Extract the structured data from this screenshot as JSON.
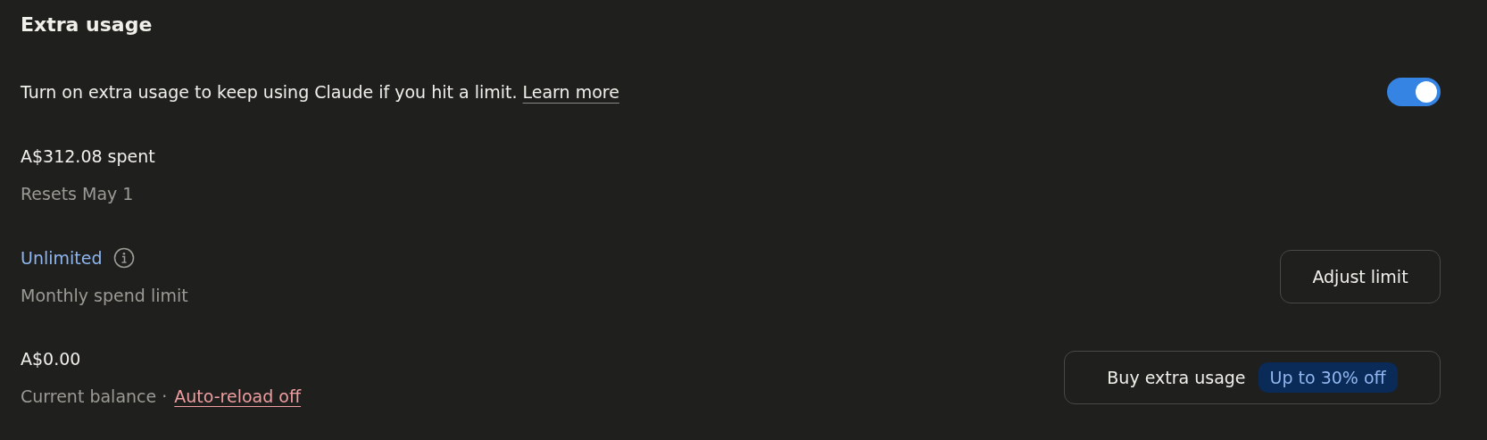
{
  "section": {
    "title": "Extra usage"
  },
  "extra_usage": {
    "description": "Turn on extra usage to keep using Claude if you hit a limit.",
    "link": "Learn more",
    "on": true
  },
  "spend": {
    "amount": "A$312.08 spent",
    "note": "Resets May 1"
  },
  "limit": {
    "value": "Unlimited",
    "label": "Monthly spend limit",
    "button": "Adjust limit"
  },
  "balance": {
    "amount": "A$0.00",
    "label": "Current balance ·",
    "link": "Auto-reload off",
    "button": "Buy extra usage",
    "badge": "Up to 30% off"
  }
}
